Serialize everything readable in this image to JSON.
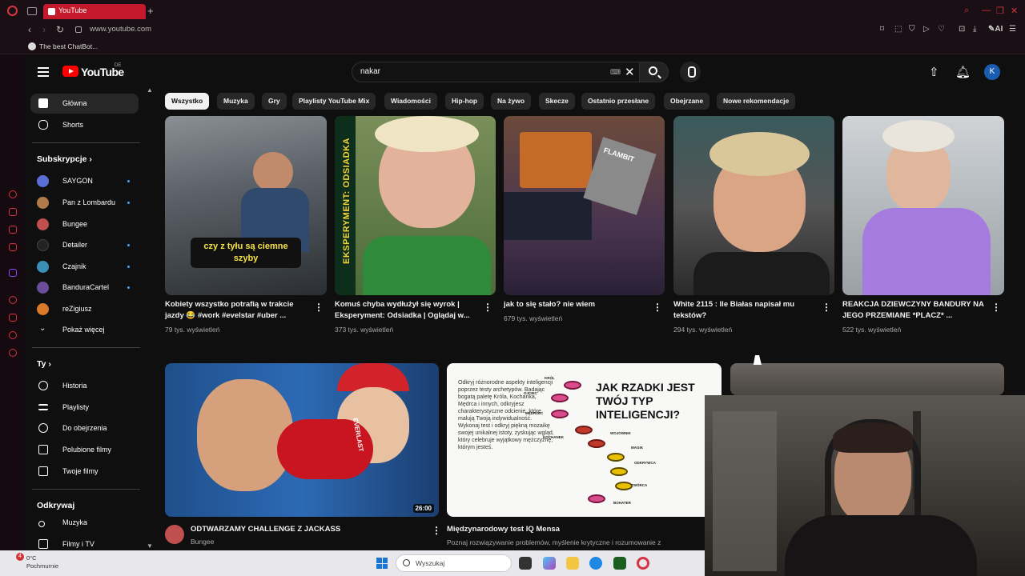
{
  "browser": {
    "tab_title": "YouTube",
    "url": "www.youtube.com",
    "bookmark": "The best ChatBot..."
  },
  "header": {
    "logo_text": "YouTube",
    "country": "DE",
    "search_value": "nakar",
    "avatar_letter": "K"
  },
  "sidebar": {
    "main": [
      {
        "label": "Główna",
        "icon": "home-icon"
      },
      {
        "label": "Shorts",
        "icon": "shorts-icon"
      }
    ],
    "subs_heading": "Subskrypcje",
    "subscriptions": [
      {
        "label": "SAYGON",
        "color": "#5a6fd6",
        "dot": true
      },
      {
        "label": "Pan z Lombardu",
        "color": "#b07a4a",
        "dot": true
      },
      {
        "label": "Bungee",
        "color": "#c0504d",
        "dot": false
      },
      {
        "label": "Detailer",
        "color": "#222222",
        "dot": true
      },
      {
        "label": "Czajnik",
        "color": "#3a8fb7",
        "dot": true
      },
      {
        "label": "BanduraCartel",
        "color": "#6b4c9a",
        "dot": true
      },
      {
        "label": "reZigiusz",
        "color": "#d97a2a",
        "dot": false
      }
    ],
    "show_more": "Pokaż więcej",
    "you_heading": "Ty",
    "you": [
      {
        "label": "Historia",
        "icon": "history-icon"
      },
      {
        "label": "Playlisty",
        "icon": "playlist-icon"
      },
      {
        "label": "Do obejrzenia",
        "icon": "watch-later-icon"
      },
      {
        "label": "Polubione filmy",
        "icon": "like-icon"
      },
      {
        "label": "Twoje filmy",
        "icon": "video-icon"
      }
    ],
    "explore_heading": "Odkrywaj",
    "explore": [
      {
        "label": "Muzyka",
        "icon": "music-icon"
      },
      {
        "label": "Filmy i TV",
        "icon": "film-icon"
      }
    ]
  },
  "chips": [
    "Wszystko",
    "Muzyka",
    "Gry",
    "Playlisty YouTube Mix",
    "Wiadomości",
    "Hip-hop",
    "Na żywo",
    "Skecze",
    "Ostatnio przesłane",
    "Obejrzane",
    "Nowe rekomendacje"
  ],
  "shorts": [
    {
      "title": "Kobiety wszystko potrafią w trakcie jazdy 😂 #work #evelstar #uber ...",
      "views": "79 tys. wyświetleń",
      "caption": "czy z tyłu są ciemne szyby"
    },
    {
      "title": "Komuś chyba wydłużył się wyrok | Eksperyment: Odsiadka | Oglądaj w...",
      "views": "373 tys. wyświetleń",
      "banner": "EKSPERYMENT: ODSIADKA"
    },
    {
      "title": "jak to się stało? nie wiem",
      "views": "679 tys. wyświetleń",
      "overlay": "FLAMBIT"
    },
    {
      "title": "White 2115 : Ile Białas napisał mu tekstów?",
      "views": "294 tys. wyświetleń"
    },
    {
      "title": "REAKCJA DZIEWCZYNY BANDURY NA JEGO PRZEMIANE *PLACZ* ...",
      "views": "522 tys. wyświetleń"
    }
  ],
  "videos": [
    {
      "title": "ODTWARZAMY CHALLENGE Z JACKASS",
      "channel": "Bungee",
      "duration": "26:00",
      "glove_text": "EVERLAST"
    },
    {
      "title": "Międzynarodowy test IQ Mensa",
      "desc": "Poznaj rozwiązywanie problemów, myślenie krytyczne i rozumowanie z",
      "thumb_left": "Odkryj różnorodne aspekty inteligencji poprzez testy archetypów. Badając bogatą paletę Króla, Kochanka, Mędrca i innych, odkryjesz charakterystyczne odcienie, które malują Twoją indywidualność. Wykonaj test i odkryj piękną mozaikę swojej unikalnej istoty, zyskując wgląd, który celebruje wyjątkowy mężczyznę, którym jesteś.",
      "thumb_right": "JAK RZADKI JEST TWÓJ TYP INTELIGENCJI?",
      "eye_labels": [
        "KRÓL",
        "OJCIEC",
        "MĘDRZEC",
        "KOCHANEK",
        "WOJOWNIK",
        "MAGIK",
        "ODKRYWCA",
        "TWÓRCA",
        "BOHATER"
      ]
    }
  ],
  "taskbar": {
    "temp": "0°C",
    "weather": "Pochmurnie",
    "notif": "4",
    "search_placeholder": "Wyszukaj"
  }
}
